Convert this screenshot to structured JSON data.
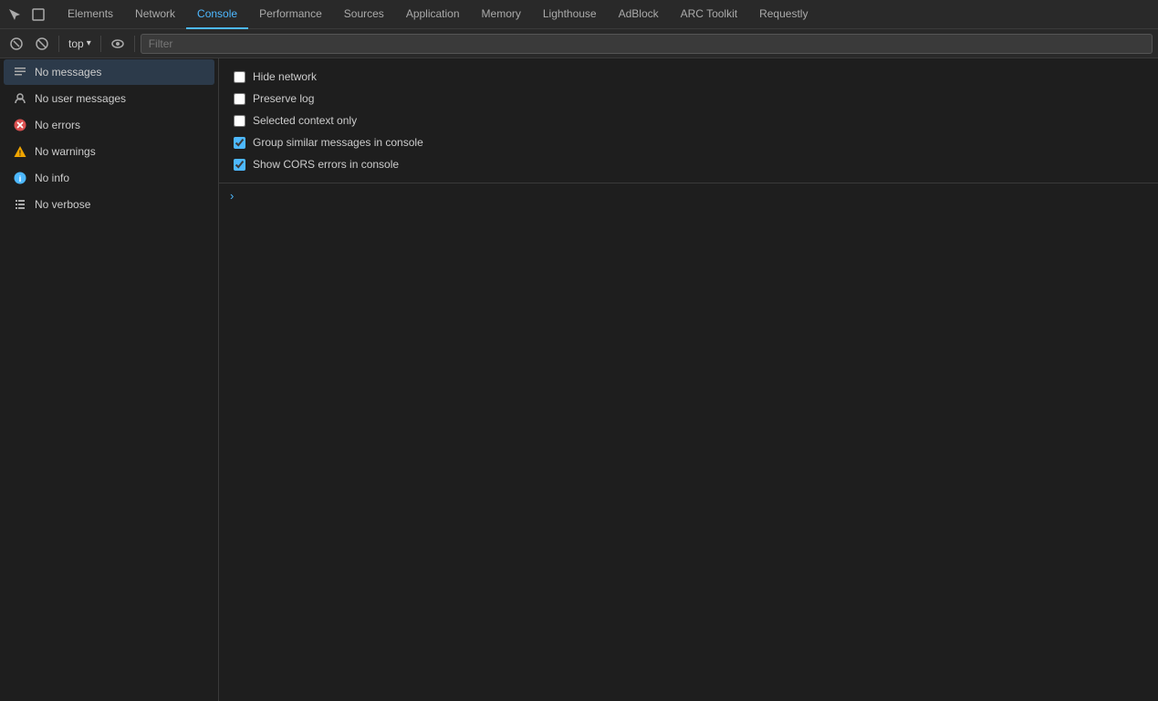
{
  "tabs": [
    {
      "id": "elements",
      "label": "Elements",
      "active": false
    },
    {
      "id": "network",
      "label": "Network",
      "active": false
    },
    {
      "id": "console",
      "label": "Console",
      "active": true
    },
    {
      "id": "performance",
      "label": "Performance",
      "active": false
    },
    {
      "id": "sources",
      "label": "Sources",
      "active": false
    },
    {
      "id": "application",
      "label": "Application",
      "active": false
    },
    {
      "id": "memory",
      "label": "Memory",
      "active": false
    },
    {
      "id": "lighthouse",
      "label": "Lighthouse",
      "active": false
    },
    {
      "id": "adblock",
      "label": "AdBlock",
      "active": false
    },
    {
      "id": "arc-toolkit",
      "label": "ARC Toolkit",
      "active": false
    },
    {
      "id": "requestly",
      "label": "Requestly",
      "active": false
    }
  ],
  "toolbar": {
    "top_label": "top",
    "filter_placeholder": "Filter"
  },
  "sidebar": {
    "items": [
      {
        "id": "messages",
        "label": "No messages",
        "icon": "≡",
        "icon_color": "icon-messages",
        "active": true
      },
      {
        "id": "user-messages",
        "label": "No user messages",
        "icon": "○",
        "icon_color": "icon-user",
        "active": false
      },
      {
        "id": "errors",
        "label": "No errors",
        "icon": "✕",
        "icon_color": "icon-error",
        "active": false
      },
      {
        "id": "warnings",
        "label": "No warnings",
        "icon": "⚠",
        "icon_color": "icon-warning",
        "active": false
      },
      {
        "id": "info",
        "label": "No info",
        "icon": "ℹ",
        "icon_color": "icon-info",
        "active": false
      },
      {
        "id": "verbose",
        "label": "No verbose",
        "icon": "❋",
        "icon_color": "icon-verbose",
        "active": false
      }
    ]
  },
  "options": [
    {
      "id": "hide-network",
      "label": "Hide network",
      "checked": false
    },
    {
      "id": "preserve-log",
      "label": "Preserve log",
      "checked": false
    },
    {
      "id": "selected-context",
      "label": "Selected context only",
      "checked": false
    },
    {
      "id": "group-similar",
      "label": "Group similar messages in console",
      "checked": true
    },
    {
      "id": "show-cors",
      "label": "Show CORS errors in console",
      "checked": true
    }
  ],
  "icons": {
    "cursor": "⬡",
    "inspect": "☐",
    "ban": "⊘",
    "eye": "👁",
    "chevron": "▾",
    "prompt": "›"
  }
}
